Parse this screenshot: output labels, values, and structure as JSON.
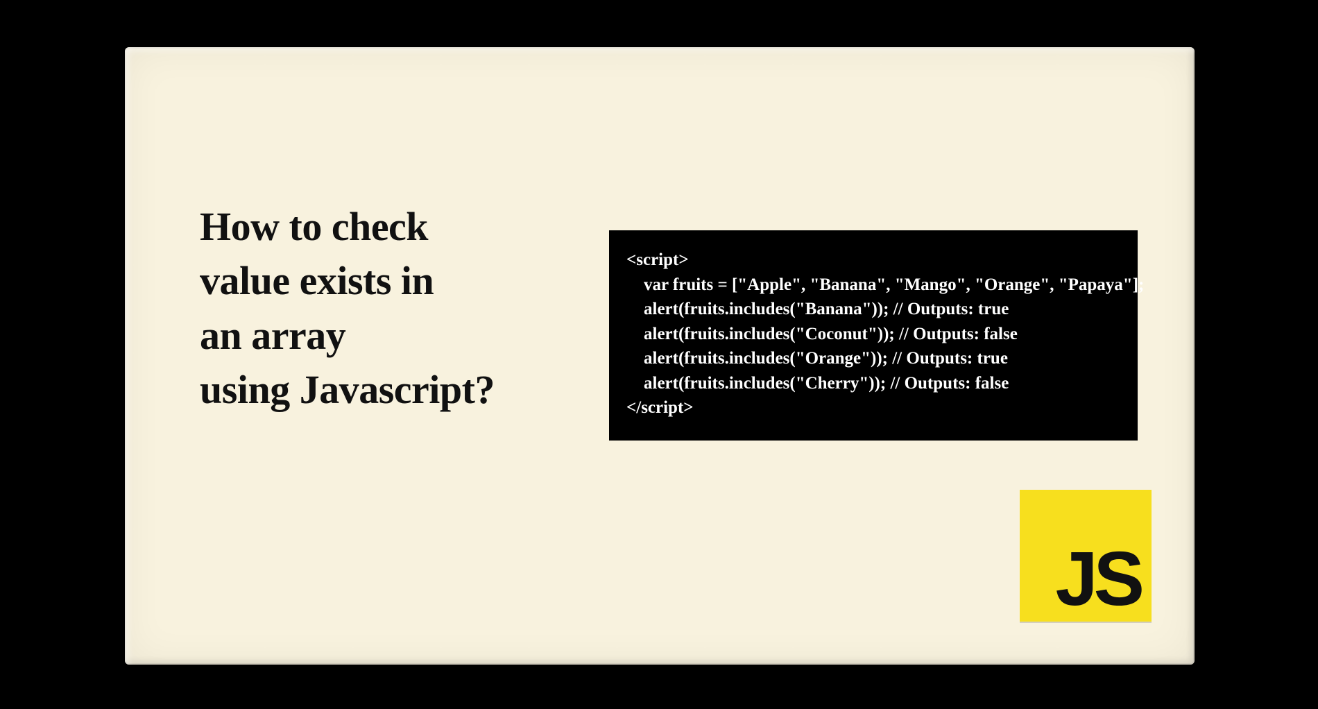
{
  "title_lines": [
    "How to check",
    "value exists in",
    "an array",
    "using Javascript?"
  ],
  "code_lines": [
    "<script>",
    "    var fruits = [\"Apple\", \"Banana\", \"Mango\", \"Orange\", \"Papaya\"];",
    "    alert(fruits.includes(\"Banana\")); // Outputs: true",
    "    alert(fruits.includes(\"Coconut\")); // Outputs: false",
    "    alert(fruits.includes(\"Orange\")); // Outputs: true",
    "    alert(fruits.includes(\"Cherry\")); // Outputs: false",
    "</script>"
  ],
  "badge": {
    "label": "JS",
    "bg": "#f7df1e",
    "fg": "#111111"
  },
  "colors": {
    "page_bg": "#000000",
    "card_bg": "#f8f2de",
    "title_fg": "#111111",
    "code_bg": "#000000",
    "code_fg": "#ffffff"
  }
}
